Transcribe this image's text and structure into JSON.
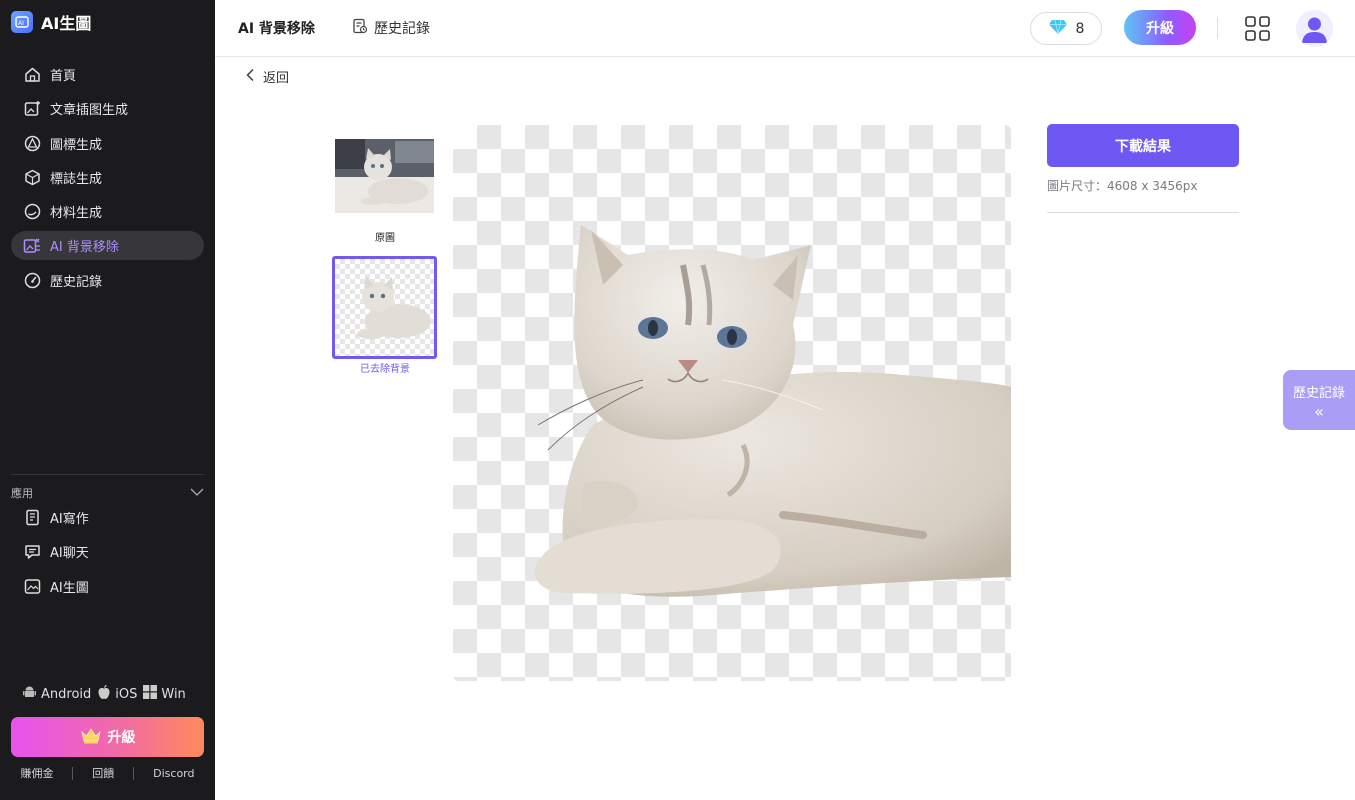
{
  "brand": {
    "name": "AI生圖"
  },
  "sidebar": {
    "items": [
      {
        "label": "首頁",
        "icon": "home-icon"
      },
      {
        "label": "文章插图生成",
        "icon": "image-plus-icon"
      },
      {
        "label": "圖標生成",
        "icon": "triangle-icon"
      },
      {
        "label": "標誌生成",
        "icon": "cube-icon"
      },
      {
        "label": "材料生成",
        "icon": "circle-icon"
      },
      {
        "label": "AI 背景移除",
        "icon": "remove-bg-icon",
        "active": true
      },
      {
        "label": "歷史記錄",
        "icon": "gauge-icon"
      }
    ],
    "section_title": "應用",
    "apps": [
      {
        "label": "AI寫作",
        "icon": "document-icon"
      },
      {
        "label": "AI聊天",
        "icon": "chat-icon"
      },
      {
        "label": "AI生圖",
        "icon": "picture-icon"
      }
    ],
    "platforms": [
      "Android",
      "iOS",
      "Win"
    ],
    "upgrade_label": "升級",
    "footer_links": [
      "賺佣金",
      "回饋",
      "Discord"
    ]
  },
  "header": {
    "title": "AI 背景移除",
    "history_label": "歷史記錄",
    "gem_count": "8",
    "upgrade_label": "升級"
  },
  "main": {
    "back_label": "返回",
    "thumb_original_label": "原圖",
    "thumb_removed_label": "已去除背景",
    "download_label": "下載結果",
    "image_size": "圖片尺寸：4608 x 3456px",
    "history_tab_label": "歷史記錄",
    "history_tab_arrow": "«"
  },
  "colors": {
    "accent": "#6e58f4",
    "sidebar_bg": "#1b1b1d",
    "active_text": "#b18cff"
  }
}
